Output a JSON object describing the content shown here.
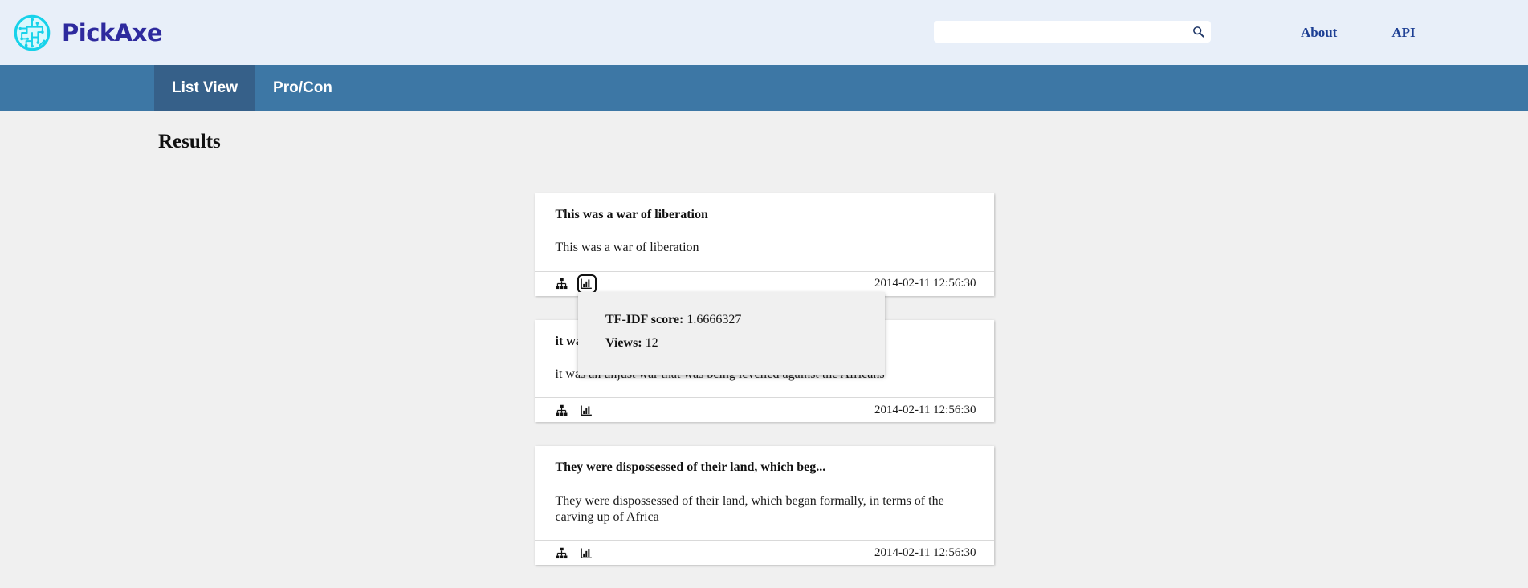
{
  "header": {
    "brand_name": "PickAxe",
    "logo_icon": "circuit-brain-logo",
    "search": {
      "value": "",
      "placeholder": "",
      "icon": "search-icon"
    },
    "nav": [
      {
        "label": "About"
      },
      {
        "label": "API"
      }
    ]
  },
  "tabs": [
    {
      "label": "List View",
      "active": true
    },
    {
      "label": "Pro/Con",
      "active": false
    }
  ],
  "main": {
    "section_title": "Results",
    "cards": [
      {
        "title": "This was a war of liberation",
        "text": "This was a war of liberation",
        "date": "2014-02-11 12:56:30",
        "tree_icon": "sitemap-icon",
        "stats_icon": "bar-chart-icon",
        "stats_focused": true
      },
      {
        "title": "it was an unjust war that was being levelled agai...",
        "text": "it was an unjust war that was being levelled against the Africans",
        "date": "2014-02-11 12:56:30",
        "tree_icon": "sitemap-icon",
        "stats_icon": "bar-chart-icon",
        "stats_focused": false
      },
      {
        "title": "They were dispossessed of their land, which beg...",
        "text": "They were dispossessed of their land, which began formally, in terms of the carving up of Africa",
        "date": "2014-02-11 12:56:30",
        "tree_icon": "sitemap-icon",
        "stats_icon": "bar-chart-icon",
        "stats_focused": false
      }
    ]
  },
  "tooltip": {
    "score_label": "TF-IDF score:",
    "score_value": "1.6666327",
    "views_label": "Views:",
    "views_value": "12"
  },
  "colors": {
    "header_bg": "#e8eff9",
    "tabbar_bg": "#3d77a5",
    "tab_active_bg": "#366089",
    "brand_text": "#2e2a9e",
    "logo_cyan": "#16d2ea",
    "nav_link": "#1d3f94",
    "page_bg": "#f0f0f0"
  }
}
